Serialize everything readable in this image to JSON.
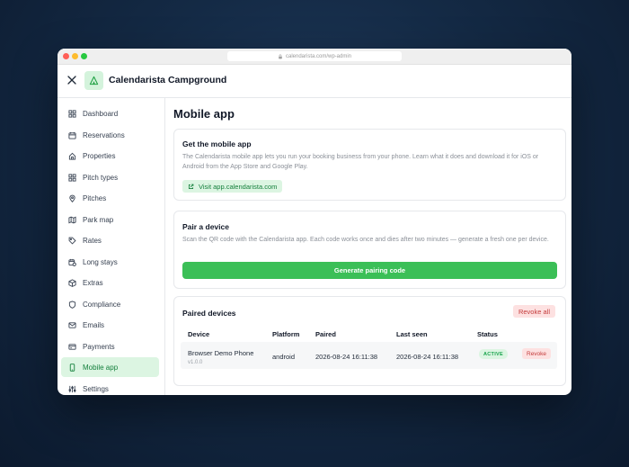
{
  "browser": {
    "url": "calendarista.com/wp-admin"
  },
  "header": {
    "brand": "Calendarista Campground"
  },
  "sidebar": {
    "items": [
      {
        "label": "Dashboard",
        "icon": "grid-icon"
      },
      {
        "label": "Reservations",
        "icon": "calendar-icon"
      },
      {
        "label": "Properties",
        "icon": "properties-icon"
      },
      {
        "label": "Pitch types",
        "icon": "grid-icon"
      },
      {
        "label": "Pitches",
        "icon": "map-pin-icon"
      },
      {
        "label": "Park map",
        "icon": "map-icon"
      },
      {
        "label": "Rates",
        "icon": "tag-icon"
      },
      {
        "label": "Long stays",
        "icon": "calendar-clock-icon"
      },
      {
        "label": "Extras",
        "icon": "box-icon"
      },
      {
        "label": "Compliance",
        "icon": "shield-icon"
      },
      {
        "label": "Emails",
        "icon": "mail-icon"
      },
      {
        "label": "Payments",
        "icon": "credit-card-icon"
      },
      {
        "label": "Mobile app",
        "icon": "phone-icon",
        "active": true
      },
      {
        "label": "Settings",
        "icon": "sliders-icon"
      }
    ]
  },
  "main": {
    "title": "Mobile app",
    "get_app": {
      "title": "Get the mobile app",
      "description": "The Calendarista mobile app lets you run your booking business from your phone. Learn what it does and download it for iOS or Android from the App Store and Google Play.",
      "link_label": "Visit app.calendarista.com"
    },
    "pair": {
      "title": "Pair a device",
      "description": "Scan the QR code with the Calendarista app. Each code works once and dies after two minutes — generate a fresh one per device.",
      "button_label": "Generate pairing code"
    },
    "paired": {
      "title": "Paired devices",
      "revoke_all_label": "Revoke all",
      "columns": [
        "Device",
        "Platform",
        "Paired",
        "Last seen",
        "Status"
      ],
      "rows": [
        {
          "device": "Browser Demo Phone",
          "version": "v1.0.0",
          "platform": "android",
          "paired": "2026-08-24 16:11:38",
          "last_seen": "2026-08-24 16:11:38",
          "status": "ACTIVE",
          "action": "Revoke"
        }
      ]
    }
  },
  "colors": {
    "accent": "#3bbf57",
    "accent_light": "#dcf5e2",
    "danger": "#c43c3c",
    "danger_light": "#fde1e1"
  }
}
